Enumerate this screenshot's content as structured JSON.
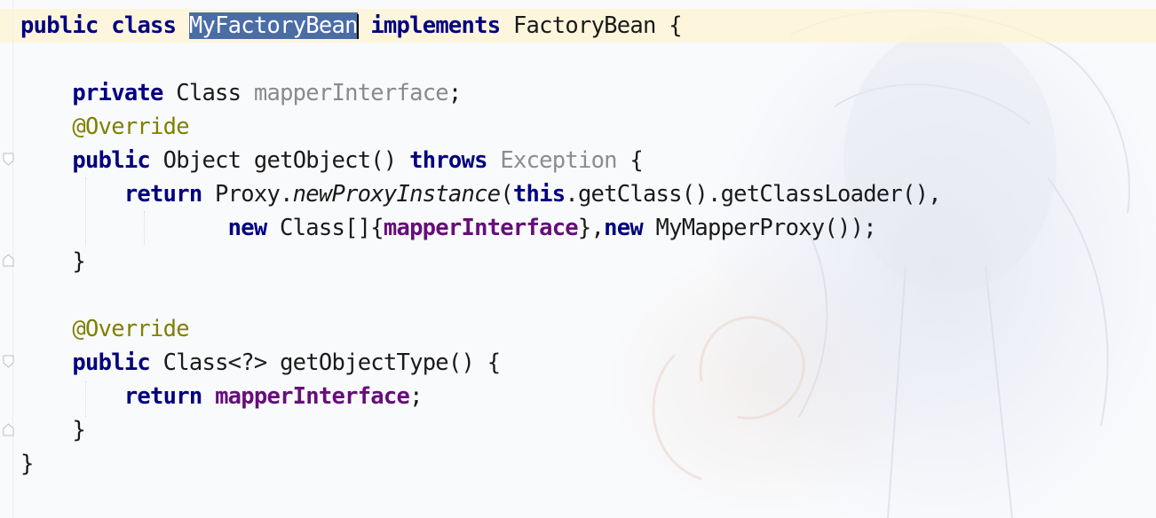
{
  "editor": {
    "lines": [
      {
        "tokens": [
          {
            "text": "public",
            "kind": "kw"
          },
          {
            "text": " "
          },
          {
            "text": "class",
            "kind": "kw"
          },
          {
            "text": " "
          },
          {
            "text": "MyFactoryBean",
            "kind": "selected"
          },
          {
            "text": " "
          },
          {
            "text": "implements",
            "kind": "kw"
          },
          {
            "text": " "
          },
          {
            "text": "FactoryBean",
            "kind": "type"
          },
          {
            "text": " {"
          }
        ]
      },
      {
        "tokens": []
      },
      {
        "tokens": [
          {
            "text": "    "
          },
          {
            "text": "private",
            "kind": "kw"
          },
          {
            "text": " "
          },
          {
            "text": "Class",
            "kind": "type"
          },
          {
            "text": " "
          },
          {
            "text": "mapperInterface",
            "kind": "field-unused"
          },
          {
            "text": ";"
          }
        ]
      },
      {
        "tokens": [
          {
            "text": "    "
          },
          {
            "text": "@Override",
            "kind": "anno"
          }
        ]
      },
      {
        "tokens": [
          {
            "text": "    "
          },
          {
            "text": "public",
            "kind": "kw"
          },
          {
            "text": " "
          },
          {
            "text": "Object",
            "kind": "type"
          },
          {
            "text": " getObject() "
          },
          {
            "text": "throws",
            "kind": "kw"
          },
          {
            "text": " "
          },
          {
            "text": "Exception",
            "kind": "exc"
          },
          {
            "text": " {"
          }
        ]
      },
      {
        "tokens": [
          {
            "text": "        "
          },
          {
            "text": "return",
            "kind": "kw"
          },
          {
            "text": " Proxy."
          },
          {
            "text": "newProxyInstance",
            "kind": "static-call"
          },
          {
            "text": "("
          },
          {
            "text": "this",
            "kind": "kw"
          },
          {
            "text": ".getClass().getClassLoader(),"
          }
        ]
      },
      {
        "tokens": [
          {
            "text": "                "
          },
          {
            "text": "new",
            "kind": "kw"
          },
          {
            "text": " Class[]{"
          },
          {
            "text": "mapperInterface",
            "kind": "field"
          },
          {
            "text": "},"
          },
          {
            "text": "new",
            "kind": "kw"
          },
          {
            "text": " MyMapperProxy());"
          }
        ]
      },
      {
        "tokens": [
          {
            "text": "    }"
          }
        ]
      },
      {
        "tokens": []
      },
      {
        "tokens": [
          {
            "text": "    "
          },
          {
            "text": "@Override",
            "kind": "anno"
          }
        ]
      },
      {
        "tokens": [
          {
            "text": "    "
          },
          {
            "text": "public",
            "kind": "kw"
          },
          {
            "text": " "
          },
          {
            "text": "Class",
            "kind": "type"
          },
          {
            "text": "<?> getObjectType() {"
          }
        ]
      },
      {
        "tokens": [
          {
            "text": "        "
          },
          {
            "text": "return",
            "kind": "kw"
          },
          {
            "text": " "
          },
          {
            "text": "mapperInterface",
            "kind": "field"
          },
          {
            "text": ";"
          }
        ]
      },
      {
        "tokens": [
          {
            "text": "    }"
          }
        ]
      },
      {
        "tokens": [
          {
            "text": "}"
          }
        ]
      }
    ]
  },
  "colors": {
    "keyword": "#000080",
    "field": "#660e7a",
    "annotation": "#808000",
    "unused": "#8a8a8a",
    "selection": "#4a6da7",
    "current_line": "#fff4d2"
  },
  "gutter": {
    "fold_icons": [
      "fold-open-icon",
      "fold-close-icon",
      "fold-open-icon",
      "fold-close-icon"
    ]
  }
}
